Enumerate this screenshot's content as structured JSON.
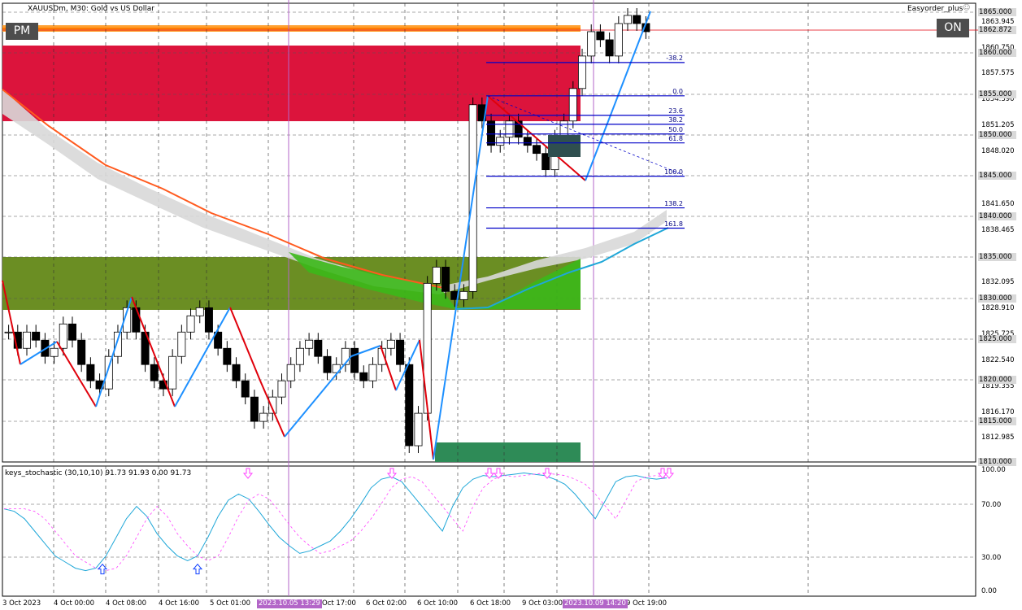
{
  "header": {
    "symbol_title": "XAUUSDm, M30:  Gold vs US Dollar",
    "ea_name": "Easyorder_plus"
  },
  "buttons": {
    "pm_label": "PM",
    "on_label": "ON"
  },
  "price_axis": {
    "ticks": [
      "1863.945",
      "1860.750",
      "1857.575",
      "1854.390",
      "1851.205",
      "1848.020",
      "1841.650",
      "1838.465",
      "1832.095",
      "1828.910",
      "1825.725",
      "1822.540",
      "1819.355",
      "1816.170",
      "1812.985"
    ],
    "tags": [
      "1865.000",
      "1862.872",
      "1860.000",
      "1855.000",
      "1850.000",
      "1845.000",
      "1840.000",
      "1835.000",
      "1830.000",
      "1825.000",
      "1820.000",
      "1815.000",
      "1810.000"
    ]
  },
  "indicator": {
    "label": "keys_stochastic (30,10,10) 91.73 91.93 0.00 91.73",
    "ticks": [
      "100.00",
      "70.00",
      "30.00",
      "0.00"
    ]
  },
  "time_axis": {
    "ticks": [
      "3 Oct 2023",
      "4 Oct 00:00",
      "4 Oct 08:00",
      "4 Oct 16:00",
      "5 Oct 01:00",
      "Oct 17:00",
      "6 Oct 02:00",
      "6 Oct 10:00",
      "6 Oct 18:00",
      "9 Oct 03:00",
      "9 Oct 19:00"
    ],
    "highlighted": [
      "2023.10.05 13:29",
      "2023.10.09 14:20"
    ]
  },
  "fibonacci": {
    "levels": [
      "-38.2",
      "0.0",
      "23.6",
      "38.2",
      "50.0",
      "61.8",
      "100.0",
      "138.2",
      "161.8"
    ]
  },
  "colors": {
    "zone_red": "#dc143c",
    "zone_olive": "#6b8e23",
    "zone_green": "#2e8b57",
    "zigzag_up": "#1e90ff",
    "zigzag_down": "#e0000b",
    "ma_orange": "#ff5a1e",
    "fib_blue": "#0000c8",
    "marker_magenta": "#b366c8"
  },
  "chart_data": {
    "type": "candlestick",
    "symbol": "XAUUSDm",
    "timeframe": "M30",
    "ylim": [
      1810.0,
      1866.5
    ],
    "approx_close_path": [
      1826,
      1824,
      1826,
      1825,
      1823,
      1824,
      1827,
      1825,
      1822,
      1820,
      1819,
      1823,
      1826,
      1829,
      1826,
      1822,
      1820,
      1819,
      1823,
      1826,
      1828,
      1829,
      1826,
      1824,
      1822,
      1820,
      1818,
      1815,
      1816,
      1818,
      1820,
      1822,
      1824,
      1825,
      1823,
      1821,
      1822,
      1824,
      1821,
      1820,
      1822,
      1824,
      1825,
      1822,
      1812,
      1816,
      1832,
      1834,
      1831,
      1830,
      1831,
      1854,
      1852,
      1849,
      1850,
      1852,
      1850,
      1849,
      1848,
      1846,
      1850,
      1852,
      1856,
      1860,
      1863,
      1862,
      1860,
      1864,
      1865,
      1864,
      1863
    ],
    "fib_prices": {
      "-38.2": 1859.2,
      "0.0": 1855.1,
      "23.6": 1852.7,
      "38.2": 1851.6,
      "50.0": 1850.4,
      "61.8": 1849.3,
      "100.0": 1845.2,
      "138.2": 1841.3,
      "161.8": 1838.8
    }
  }
}
